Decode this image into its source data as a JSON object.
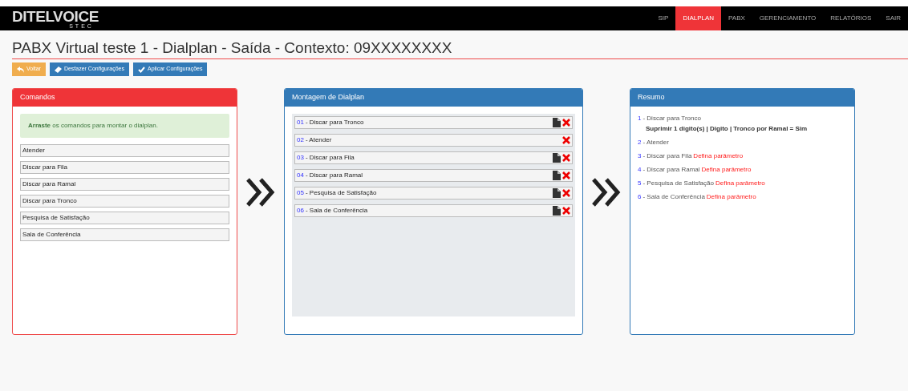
{
  "logo": {
    "main": "DITELVOICE",
    "sub": "STEC"
  },
  "nav": [
    {
      "label": "SIP",
      "selected": false
    },
    {
      "label": "DIALPLAN",
      "selected": true
    },
    {
      "label": "PABX",
      "selected": false
    },
    {
      "label": "GERENCIAMENTO",
      "selected": false
    },
    {
      "label": "RELATÓRIOS",
      "selected": false
    },
    {
      "label": "SAIR",
      "selected": false
    }
  ],
  "page_title": "PABX Virtual teste 1 - Dialplan - Saída - Contexto: 09XXXXXXXX",
  "buttons": [
    {
      "label": "Voltar",
      "kind": "back"
    },
    {
      "label": "Desfazer Configurações",
      "kind": "undo"
    },
    {
      "label": "Aplicar Configurações",
      "kind": "apply"
    }
  ],
  "commands": {
    "title": "Comandos",
    "hint": "**Arraste** os comandos para montar o dialplan.",
    "items": [
      "Atender",
      "Discar para Fila",
      "Discar para Ramal",
      "Discar para Tronco",
      "Pesquisa de Satisfação",
      "Sala de Conferência"
    ]
  },
  "dialplan": {
    "title": "Montagem de Dialplan",
    "items": [
      {
        "number": "01",
        "label": "- Discar para Tronco",
        "has_file": true
      },
      {
        "number": "02",
        "label": "- Atender",
        "has_file": false
      },
      {
        "number": "03",
        "label": "- Discar para Fila",
        "has_file": true
      },
      {
        "number": "04",
        "label": "- Discar para Ramal",
        "has_file": true
      },
      {
        "number": "05",
        "label": "- Pesquisa de Satisfação",
        "has_file": true
      },
      {
        "number": "06",
        "label": "- Sala de Conferência",
        "has_file": true
      }
    ]
  },
  "summary": {
    "title": "Resumo",
    "items": [
      {
        "number": "1",
        "label": "- Discar para Tronco",
        "detail": "Suprimir 1 digito(s) | Digito | Tronco por Ramal = Sim"
      },
      {
        "number": "2",
        "label": "- Atender"
      },
      {
        "number": "3",
        "label": "- Discar para Fila",
        "warning": "Defina parâmetro"
      },
      {
        "number": "4",
        "label": "- Discar para Ramal",
        "warning": "Defina parâmetro"
      },
      {
        "number": "5",
        "label": "- Pesquisa de Satisfação",
        "warning": "Defina parâmetro"
      },
      {
        "number": "6",
        "label": "- Sala de Conferência",
        "warning": "Defina parâmetro"
      }
    ]
  }
}
